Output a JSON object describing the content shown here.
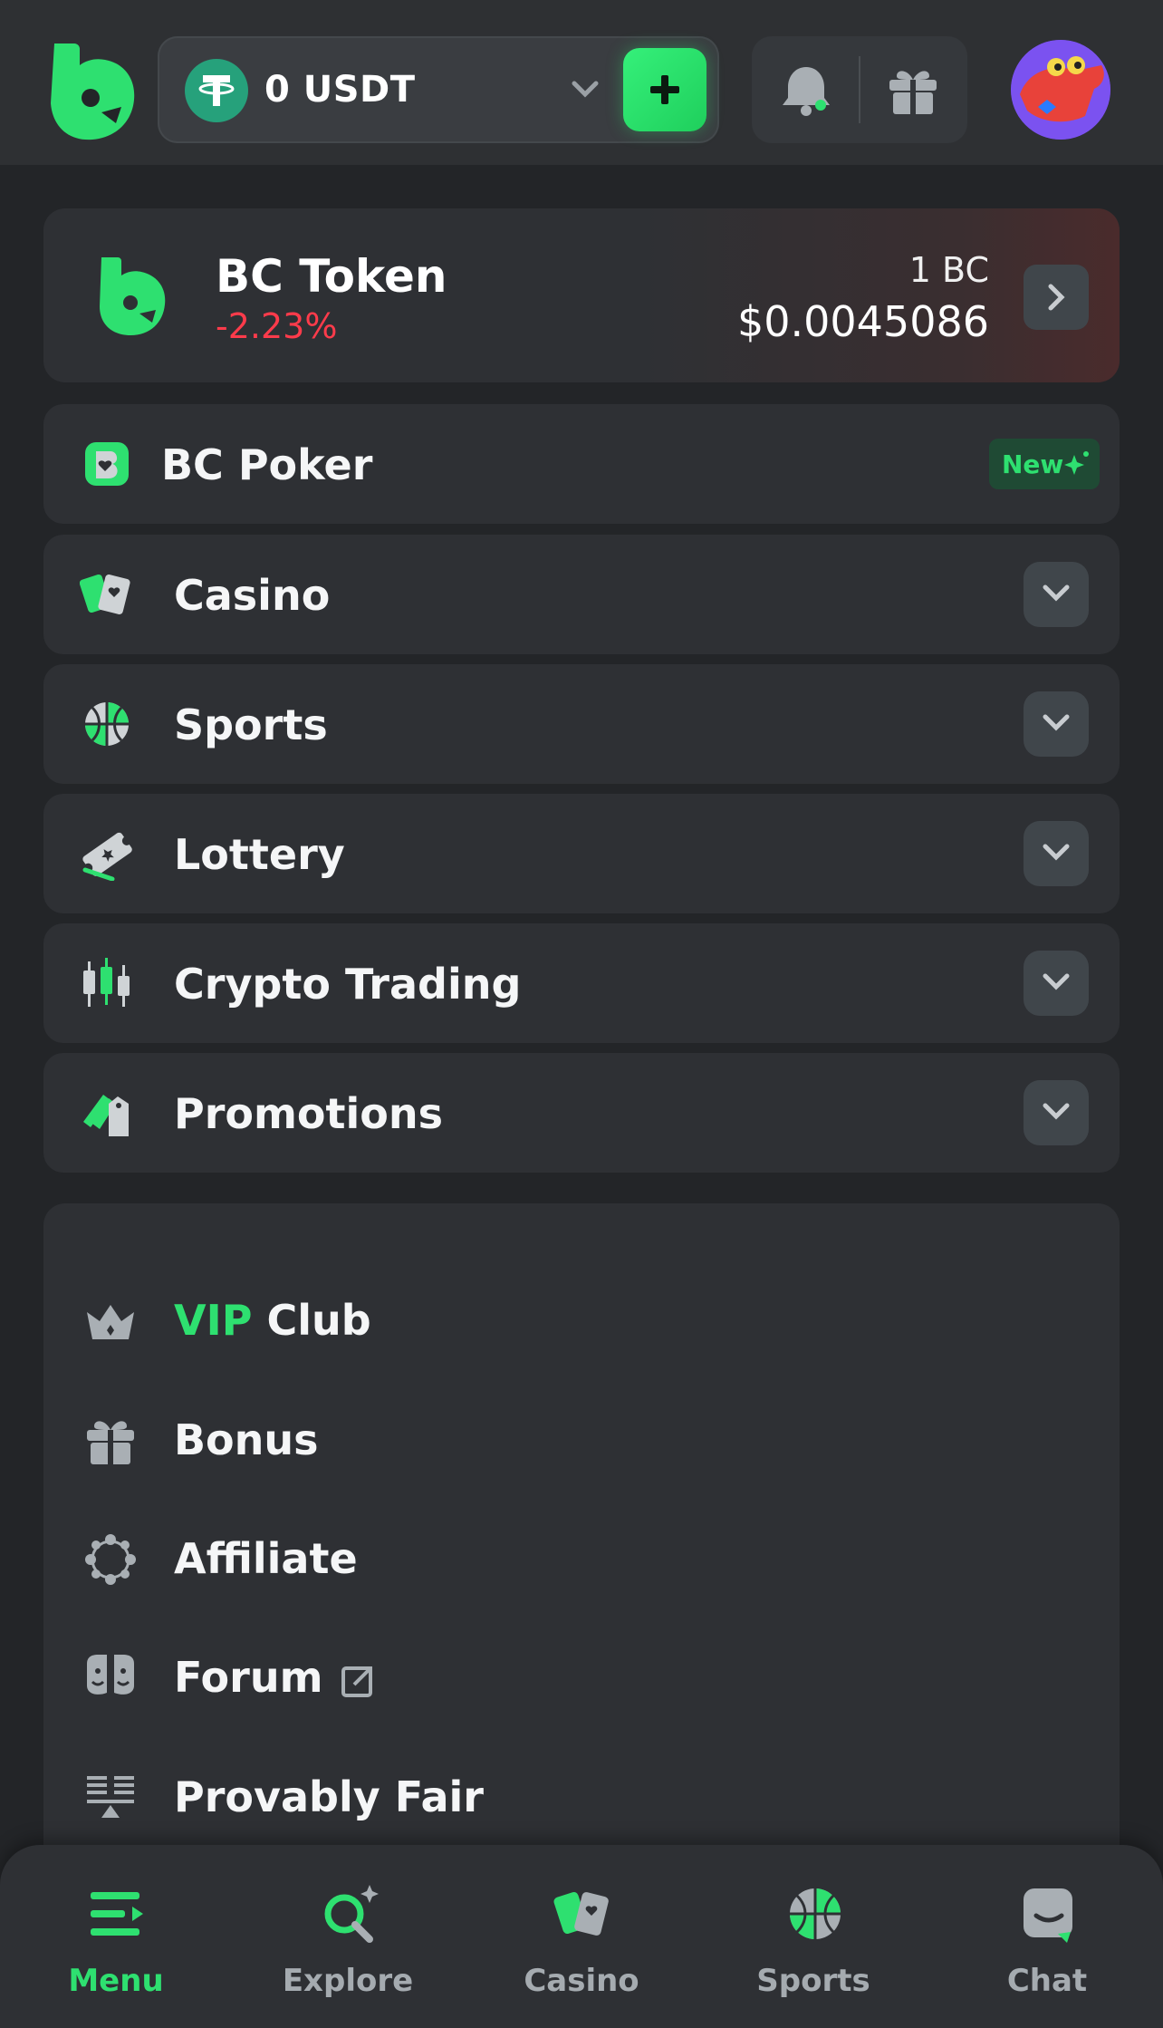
{
  "header": {
    "wallet_balance": "0 USDT",
    "icons": [
      "bcgame-logo-icon",
      "usdt-coin-icon",
      "chevron-down-icon",
      "plus-icon",
      "bell-icon",
      "gift-icon",
      "avatar"
    ]
  },
  "token_card": {
    "name": "BC Token",
    "change": "-2.23%",
    "unit": "1 BC",
    "price": "$0.0045086"
  },
  "menu": [
    {
      "label": "BC Poker",
      "icon": "poker-icon",
      "badge": "New"
    },
    {
      "label": "Casino",
      "icon": "cards-icon"
    },
    {
      "label": "Sports",
      "icon": "basketball-icon"
    },
    {
      "label": "Lottery",
      "icon": "ticket-icon"
    },
    {
      "label": "Crypto Trading",
      "icon": "candlestick-icon"
    },
    {
      "label": "Promotions",
      "icon": "tags-icon"
    }
  ],
  "links": {
    "vip_prefix": "VIP",
    "vip_suffix": " Club",
    "bonus": "Bonus",
    "affiliate": "Affiliate",
    "forum": "Forum",
    "provably_fair": "Provably Fair"
  },
  "bottom_nav": [
    {
      "label": "Menu",
      "active": true
    },
    {
      "label": "Explore"
    },
    {
      "label": "Casino"
    },
    {
      "label": "Sports"
    },
    {
      "label": "Chat"
    }
  ],
  "colors": {
    "accent": "#2ee070",
    "negative": "#ff3b4b",
    "background": "#232528",
    "card": "#2e3034"
  }
}
